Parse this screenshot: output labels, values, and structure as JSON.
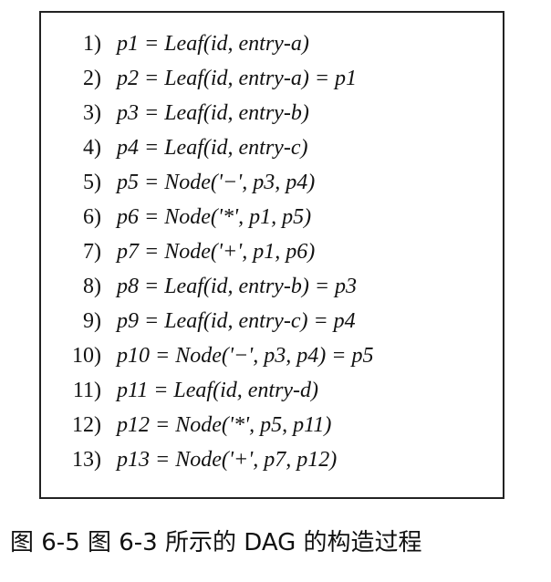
{
  "lines": [
    {
      "num": "1)",
      "expr": "p1 = Leaf(id, entry-a)"
    },
    {
      "num": "2)",
      "expr": "p2 = Leaf(id, entry-a) = p1"
    },
    {
      "num": "3)",
      "expr": "p3 = Leaf(id, entry-b)"
    },
    {
      "num": "4)",
      "expr": "p4 = Leaf(id, entry-c)"
    },
    {
      "num": "5)",
      "expr": "p5 = Node('−', p3, p4)"
    },
    {
      "num": "6)",
      "expr": "p6 = Node('*', p1, p5)"
    },
    {
      "num": "7)",
      "expr": "p7 = Node('+', p1, p6)"
    },
    {
      "num": "8)",
      "expr": "p8 = Leaf(id, entry-b) = p3"
    },
    {
      "num": "9)",
      "expr": "p9 = Leaf(id, entry-c) = p4"
    },
    {
      "num": "10)",
      "expr": "p10 = Node('−', p3, p4) = p5"
    },
    {
      "num": "11)",
      "expr": "p11 = Leaf(id, entry-d)"
    },
    {
      "num": "12)",
      "expr": "p12 = Node('*', p5, p11)"
    },
    {
      "num": "13)",
      "expr": "p13 = Node('+', p7, p12)"
    }
  ],
  "caption": "图 6-5   图 6-3 所示的 DAG 的构造过程"
}
